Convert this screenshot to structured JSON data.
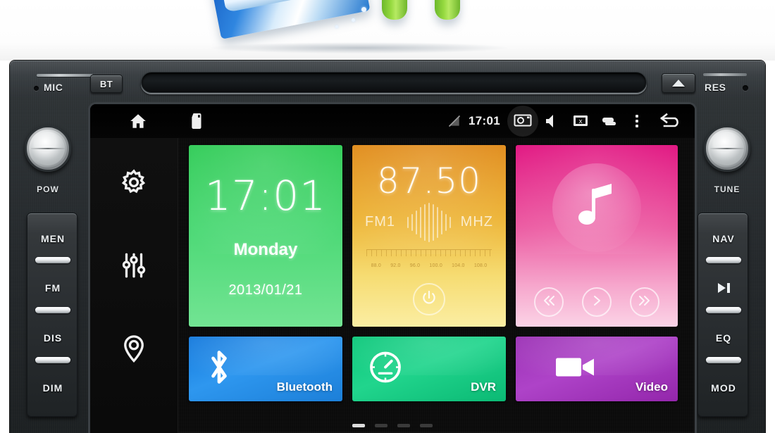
{
  "device": {
    "top_panel": {
      "mic_label": "MIC",
      "bt_button": "BT",
      "eject_icon": "eject-icon",
      "res_label": "RES",
      "cd_slot_name": "cd-slot"
    },
    "knobs": {
      "left_label": "POW",
      "right_label": "TUNE"
    },
    "left_buttons": [
      "MEN",
      "FM",
      "DIS",
      "DIM"
    ],
    "right_buttons": [
      "NAV",
      "PLAY_PAUSE",
      "EQ",
      "MOD"
    ],
    "right_button_labels": [
      "NAV",
      "",
      "EQ",
      "MOD"
    ]
  },
  "screen": {
    "statusbar": {
      "home_icon": "home-icon",
      "sdcard_icon": "sd-card-icon",
      "signal_icon": "no-signal-icon",
      "time": "17:01",
      "camera_icon": "camera-icon",
      "volume_icon": "speaker-icon",
      "screenshot_icon": "screen-close-icon",
      "recents_icon": "recent-apps-icon",
      "overflow_icon": "more-vertical-icon",
      "back_icon": "back-arrow-icon"
    },
    "left_rail": [
      {
        "name": "settings-icon",
        "label": "Settings"
      },
      {
        "name": "equalizer-icon",
        "label": "Equalizer"
      },
      {
        "name": "location-icon",
        "label": "Navigation"
      }
    ],
    "tiles": {
      "clock": {
        "time": "17:01",
        "day": "Monday",
        "date": "2013/01/21",
        "color": "#2ecb55"
      },
      "radio": {
        "frequency": "87.50",
        "band": "FM1",
        "unit": "MHZ",
        "color": "#e08a18",
        "scale_ticks": [
          "88.0",
          "92.0",
          "96.0",
          "100.0",
          "104.0",
          "108.0"
        ],
        "power_icon": "power-icon"
      },
      "music": {
        "icon": "music-note-icon",
        "color": "#e0107e",
        "controls": [
          "prev-icon",
          "play-icon",
          "next-icon"
        ]
      },
      "bluetooth": {
        "label": "Bluetooth",
        "icon": "bluetooth-icon",
        "color": "#1479dc"
      },
      "dvr": {
        "label": "DVR",
        "icon": "speedometer-icon",
        "color": "#0cc77a"
      },
      "video": {
        "label": "Video",
        "icon": "video-camera-icon",
        "color": "#9b31b5"
      }
    },
    "pager": {
      "pages": 4,
      "active": 1
    }
  }
}
